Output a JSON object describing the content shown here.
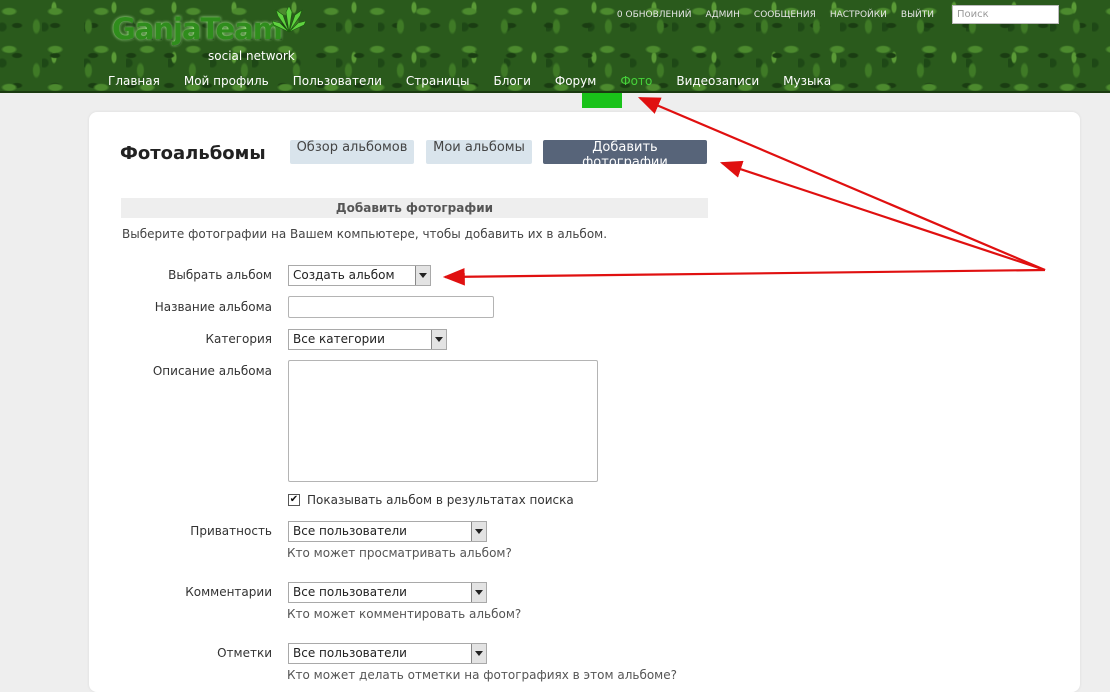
{
  "header": {
    "logo_main": "GanjaTeam",
    "logo_sub": "social network",
    "top_links": [
      "0 обновлений",
      "Админ",
      "Сообщения",
      "Настройки",
      "Выйти"
    ],
    "search_placeholder": "Поиск",
    "nav": [
      "Главная",
      "Мой профиль",
      "Пользователи",
      "Страницы",
      "Блоги",
      "Форум",
      "Фото",
      "Видеозаписи",
      "Музыка"
    ],
    "active_nav": "Фото",
    "accent_color": "#19c219"
  },
  "page": {
    "title": "Фотоальбомы",
    "tabs": [
      "Обзор альбомов",
      "Мои альбомы",
      "Добавить фотографии"
    ],
    "section_title": "Добавить фотографии",
    "hint": "Выберите фотографии на Вашем компьютере, чтобы добавить их в альбом."
  },
  "form": {
    "album_label": "Выбрать альбом",
    "album_value": "Создать альбом",
    "name_label": "Название альбома",
    "name_value": "",
    "category_label": "Категория",
    "category_value": "Все категории",
    "description_label": "Описание альбома",
    "description_value": "",
    "search_checkbox_label": "Показывать альбом в результатах поиска",
    "search_checkbox_checked": true,
    "privacy_label": "Приватность",
    "privacy_value": "Все пользователи",
    "privacy_hint": "Кто может просматривать альбом?",
    "comments_label": "Комментарии",
    "comments_value": "Все пользователи",
    "comments_hint": "Кто может комментировать альбом?",
    "tags_label": "Отметки",
    "tags_value": "Все пользователи",
    "tags_hint": "Кто может делать отметки на фотографиях в этом альбоме?"
  },
  "annotation": {
    "arrow_color": "#e01010"
  }
}
